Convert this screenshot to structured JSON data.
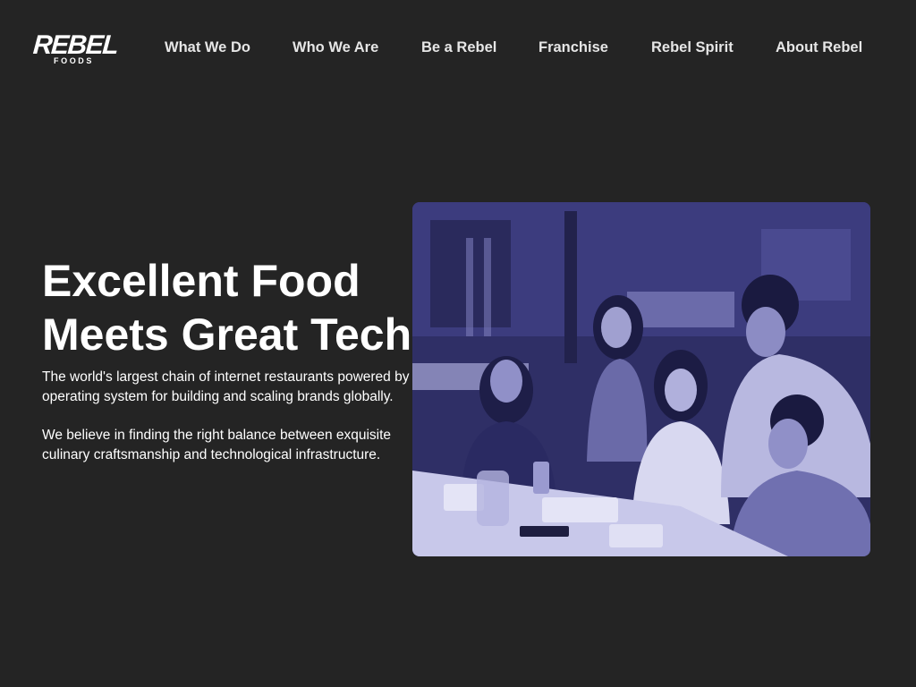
{
  "header": {
    "logo": {
      "main": "REBEL",
      "sub": "FOODS"
    },
    "nav": [
      {
        "label": "What We Do"
      },
      {
        "label": "Who We Are"
      },
      {
        "label": "Be a Rebel"
      },
      {
        "label": "Franchise"
      },
      {
        "label": "Rebel Spirit"
      },
      {
        "label": "About Rebel"
      }
    ]
  },
  "hero": {
    "title_line1": "Excellent Food",
    "title_line2": "Meets Great Tech",
    "paragraph1": "The world's largest chain of internet restaurants powered by an operating system for building and scaling brands globally.",
    "paragraph2": "We believe in finding the right balance between exquisite culinary craftsmanship and technological infrastructure."
  },
  "colors": {
    "background": "#242424",
    "text": "#ffffff",
    "photo_tint": "#3a3a78"
  }
}
